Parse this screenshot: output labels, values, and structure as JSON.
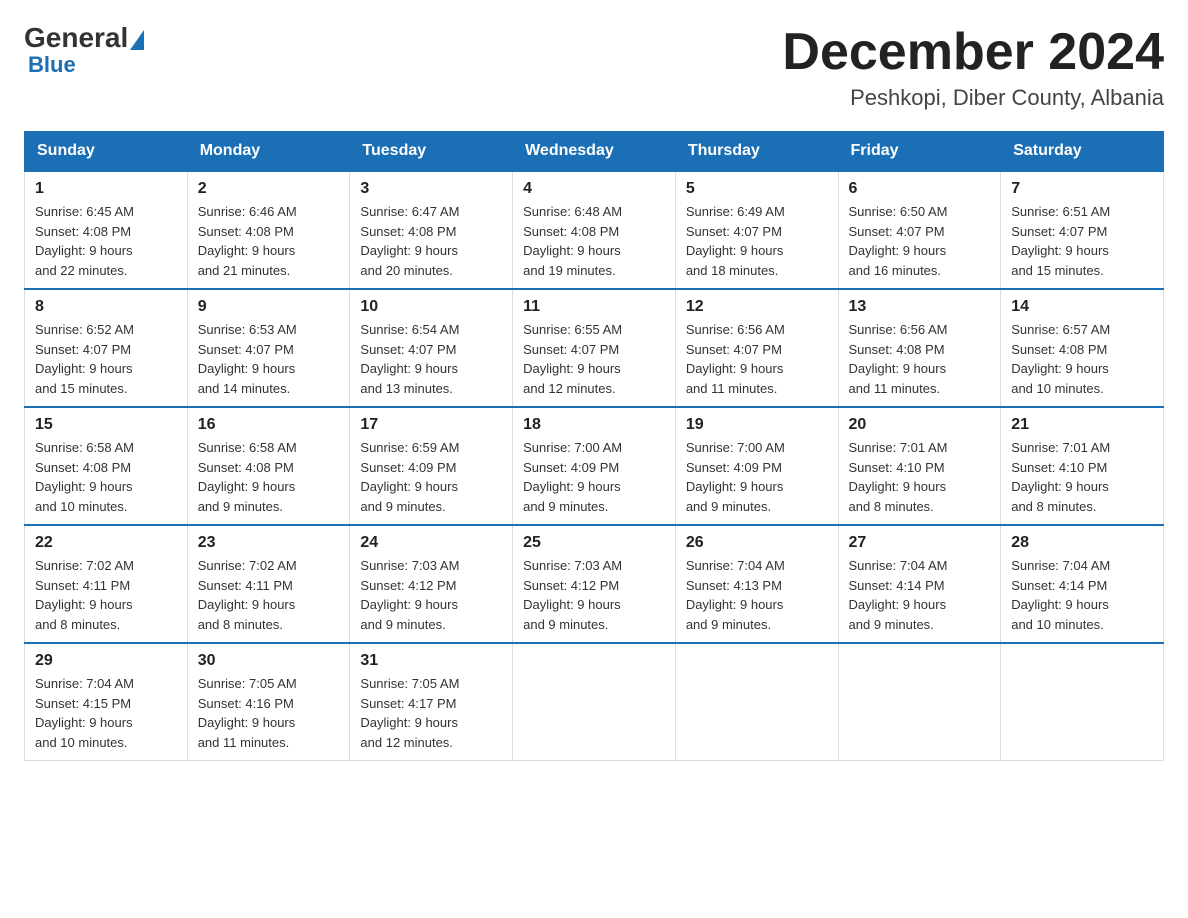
{
  "logo": {
    "general": "General",
    "blue": "Blue"
  },
  "header": {
    "month": "December 2024",
    "location": "Peshkopi, Diber County, Albania"
  },
  "days_of_week": [
    "Sunday",
    "Monday",
    "Tuesday",
    "Wednesday",
    "Thursday",
    "Friday",
    "Saturday"
  ],
  "weeks": [
    [
      {
        "day": "1",
        "sunrise": "6:45 AM",
        "sunset": "4:08 PM",
        "daylight": "9 hours and 22 minutes."
      },
      {
        "day": "2",
        "sunrise": "6:46 AM",
        "sunset": "4:08 PM",
        "daylight": "9 hours and 21 minutes."
      },
      {
        "day": "3",
        "sunrise": "6:47 AM",
        "sunset": "4:08 PM",
        "daylight": "9 hours and 20 minutes."
      },
      {
        "day": "4",
        "sunrise": "6:48 AM",
        "sunset": "4:08 PM",
        "daylight": "9 hours and 19 minutes."
      },
      {
        "day": "5",
        "sunrise": "6:49 AM",
        "sunset": "4:07 PM",
        "daylight": "9 hours and 18 minutes."
      },
      {
        "day": "6",
        "sunrise": "6:50 AM",
        "sunset": "4:07 PM",
        "daylight": "9 hours and 16 minutes."
      },
      {
        "day": "7",
        "sunrise": "6:51 AM",
        "sunset": "4:07 PM",
        "daylight": "9 hours and 15 minutes."
      }
    ],
    [
      {
        "day": "8",
        "sunrise": "6:52 AM",
        "sunset": "4:07 PM",
        "daylight": "9 hours and 15 minutes."
      },
      {
        "day": "9",
        "sunrise": "6:53 AM",
        "sunset": "4:07 PM",
        "daylight": "9 hours and 14 minutes."
      },
      {
        "day": "10",
        "sunrise": "6:54 AM",
        "sunset": "4:07 PM",
        "daylight": "9 hours and 13 minutes."
      },
      {
        "day": "11",
        "sunrise": "6:55 AM",
        "sunset": "4:07 PM",
        "daylight": "9 hours and 12 minutes."
      },
      {
        "day": "12",
        "sunrise": "6:56 AM",
        "sunset": "4:07 PM",
        "daylight": "9 hours and 11 minutes."
      },
      {
        "day": "13",
        "sunrise": "6:56 AM",
        "sunset": "4:08 PM",
        "daylight": "9 hours and 11 minutes."
      },
      {
        "day": "14",
        "sunrise": "6:57 AM",
        "sunset": "4:08 PM",
        "daylight": "9 hours and 10 minutes."
      }
    ],
    [
      {
        "day": "15",
        "sunrise": "6:58 AM",
        "sunset": "4:08 PM",
        "daylight": "9 hours and 10 minutes."
      },
      {
        "day": "16",
        "sunrise": "6:58 AM",
        "sunset": "4:08 PM",
        "daylight": "9 hours and 9 minutes."
      },
      {
        "day": "17",
        "sunrise": "6:59 AM",
        "sunset": "4:09 PM",
        "daylight": "9 hours and 9 minutes."
      },
      {
        "day": "18",
        "sunrise": "7:00 AM",
        "sunset": "4:09 PM",
        "daylight": "9 hours and 9 minutes."
      },
      {
        "day": "19",
        "sunrise": "7:00 AM",
        "sunset": "4:09 PM",
        "daylight": "9 hours and 9 minutes."
      },
      {
        "day": "20",
        "sunrise": "7:01 AM",
        "sunset": "4:10 PM",
        "daylight": "9 hours and 8 minutes."
      },
      {
        "day": "21",
        "sunrise": "7:01 AM",
        "sunset": "4:10 PM",
        "daylight": "9 hours and 8 minutes."
      }
    ],
    [
      {
        "day": "22",
        "sunrise": "7:02 AM",
        "sunset": "4:11 PM",
        "daylight": "9 hours and 8 minutes."
      },
      {
        "day": "23",
        "sunrise": "7:02 AM",
        "sunset": "4:11 PM",
        "daylight": "9 hours and 8 minutes."
      },
      {
        "day": "24",
        "sunrise": "7:03 AM",
        "sunset": "4:12 PM",
        "daylight": "9 hours and 9 minutes."
      },
      {
        "day": "25",
        "sunrise": "7:03 AM",
        "sunset": "4:12 PM",
        "daylight": "9 hours and 9 minutes."
      },
      {
        "day": "26",
        "sunrise": "7:04 AM",
        "sunset": "4:13 PM",
        "daylight": "9 hours and 9 minutes."
      },
      {
        "day": "27",
        "sunrise": "7:04 AM",
        "sunset": "4:14 PM",
        "daylight": "9 hours and 9 minutes."
      },
      {
        "day": "28",
        "sunrise": "7:04 AM",
        "sunset": "4:14 PM",
        "daylight": "9 hours and 10 minutes."
      }
    ],
    [
      {
        "day": "29",
        "sunrise": "7:04 AM",
        "sunset": "4:15 PM",
        "daylight": "9 hours and 10 minutes."
      },
      {
        "day": "30",
        "sunrise": "7:05 AM",
        "sunset": "4:16 PM",
        "daylight": "9 hours and 11 minutes."
      },
      {
        "day": "31",
        "sunrise": "7:05 AM",
        "sunset": "4:17 PM",
        "daylight": "9 hours and 12 minutes."
      },
      null,
      null,
      null,
      null
    ]
  ],
  "labels": {
    "sunrise": "Sunrise:",
    "sunset": "Sunset:",
    "daylight": "Daylight:"
  }
}
